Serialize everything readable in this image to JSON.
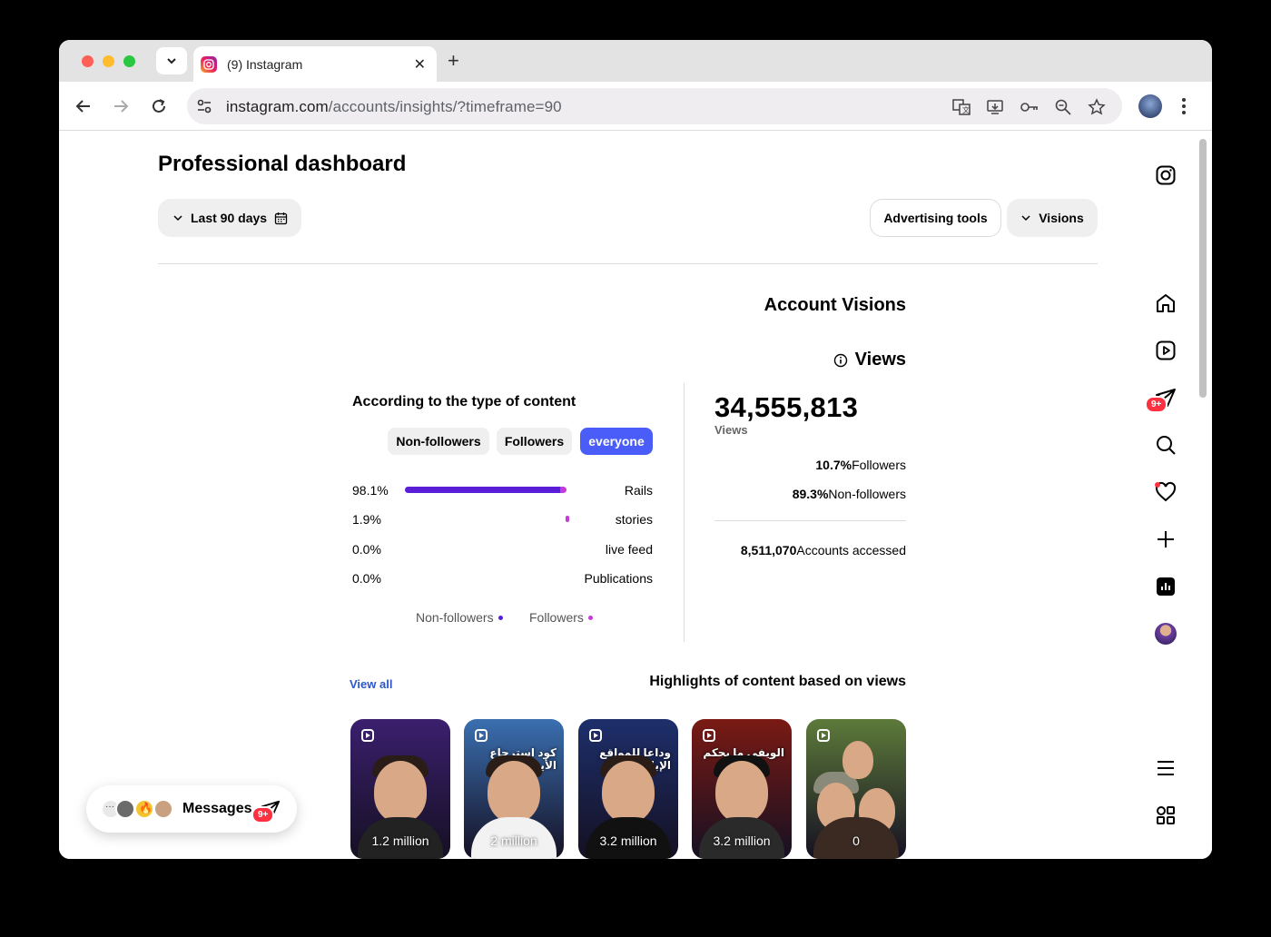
{
  "browser": {
    "tab_title": "(9) Instagram",
    "url_host": "instagram.com",
    "url_path": "/accounts/insights/?timeframe=90"
  },
  "page": {
    "title": "Professional dashboard",
    "timeframe_label": "Last 90 days",
    "advertising_tools_label": "Advertising tools",
    "visions_label": "Visions"
  },
  "account": {
    "section_title": "Account Visions",
    "views_title": "Views",
    "total_views": "34,555,813",
    "total_views_label": "Views",
    "followers_pct": "10.7%",
    "followers_label": "Followers",
    "nonfollowers_pct": "89.3%",
    "nonfollowers_label": "Non-followers",
    "accounts_accessed": "8,511,070",
    "accounts_accessed_label": "Accounts accessed"
  },
  "content_type": {
    "title": "According to the type of content",
    "segments": [
      "Non-followers",
      "Followers",
      "everyone"
    ],
    "selected_segment": "everyone",
    "rows": [
      {
        "pct": "98.1%",
        "label": "Rails",
        "nonfollower_share": 0.945,
        "follower_share": 0.036
      },
      {
        "pct": "1.9%",
        "label": "stories",
        "nonfollower_share": 0.0,
        "follower_share": 0.019
      },
      {
        "pct": "0.0%",
        "label": "live feed",
        "nonfollower_share": 0.0,
        "follower_share": 0.0
      },
      {
        "pct": "0.0%",
        "label": "Publications",
        "nonfollower_share": 0.0,
        "follower_share": 0.0
      }
    ],
    "legend": [
      {
        "label": "Non-followers",
        "color": "#5a1ed8"
      },
      {
        "label": "Followers",
        "color": "#c43cd6"
      }
    ]
  },
  "highlights": {
    "view_all_label": "View all",
    "title": "Highlights of content based on views",
    "items": [
      {
        "views": "1.2 million",
        "overlay": "",
        "bg": "#3b1f6e"
      },
      {
        "views": "2 million",
        "overlay": "كود استرجاع الأيفون",
        "bg": "#3a6fb0"
      },
      {
        "views": "3.2 million",
        "overlay": "وداعا للمواقع الإباحية",
        "bg": "#1d2f6b"
      },
      {
        "views": "3.2 million",
        "overlay": "الويفي ما يحكم",
        "bg": "#7a1a14"
      },
      {
        "views": "0",
        "overlay": "",
        "bg": "#5d7a3a"
      }
    ]
  },
  "messages": {
    "label": "Messages",
    "badge": "9+"
  },
  "rail": {
    "messages_badge": "9+"
  },
  "colors": {
    "accent": "#4a5df9",
    "nonfollowers": "#5a1ed8",
    "followers": "#c43cd6",
    "badge": "#ff3040"
  }
}
